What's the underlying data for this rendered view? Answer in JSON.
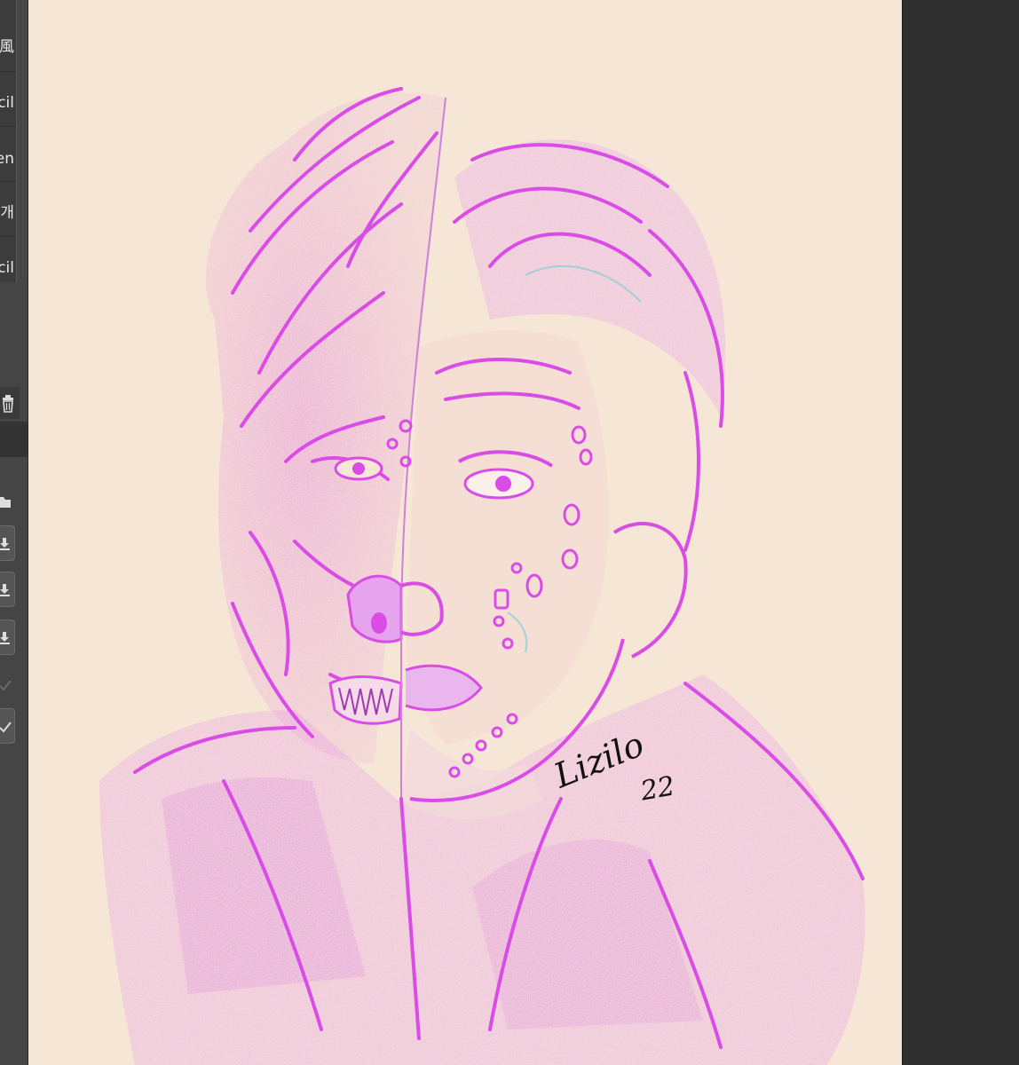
{
  "brush_panel": {
    "items": [
      {
        "label": "風",
        "icon": "brush-preset-icon"
      },
      {
        "label": "cil",
        "icon": "pencil-preset-icon"
      },
      {
        "label": "en",
        "icon": "pen-preset-icon"
      },
      {
        "label": "개",
        "icon": "brush-preset-icon"
      },
      {
        "label": "cil",
        "icon": "pencil-preset-icon"
      }
    ]
  },
  "layer_panel": {
    "buttons": [
      "folder-icon",
      "merge-down-icon",
      "merge-down-icon",
      "merge-down-icon",
      "check-disabled-icon",
      "check-icon"
    ]
  },
  "artwork": {
    "signature_text": "Lizilo 22",
    "colors": {
      "paper": "#f6e6d5",
      "stroke": "#d94ce6",
      "accent_teal": "#8ecfd6"
    }
  },
  "colors": {
    "ui_dark": "#303030",
    "ui_panel": "#474747"
  }
}
